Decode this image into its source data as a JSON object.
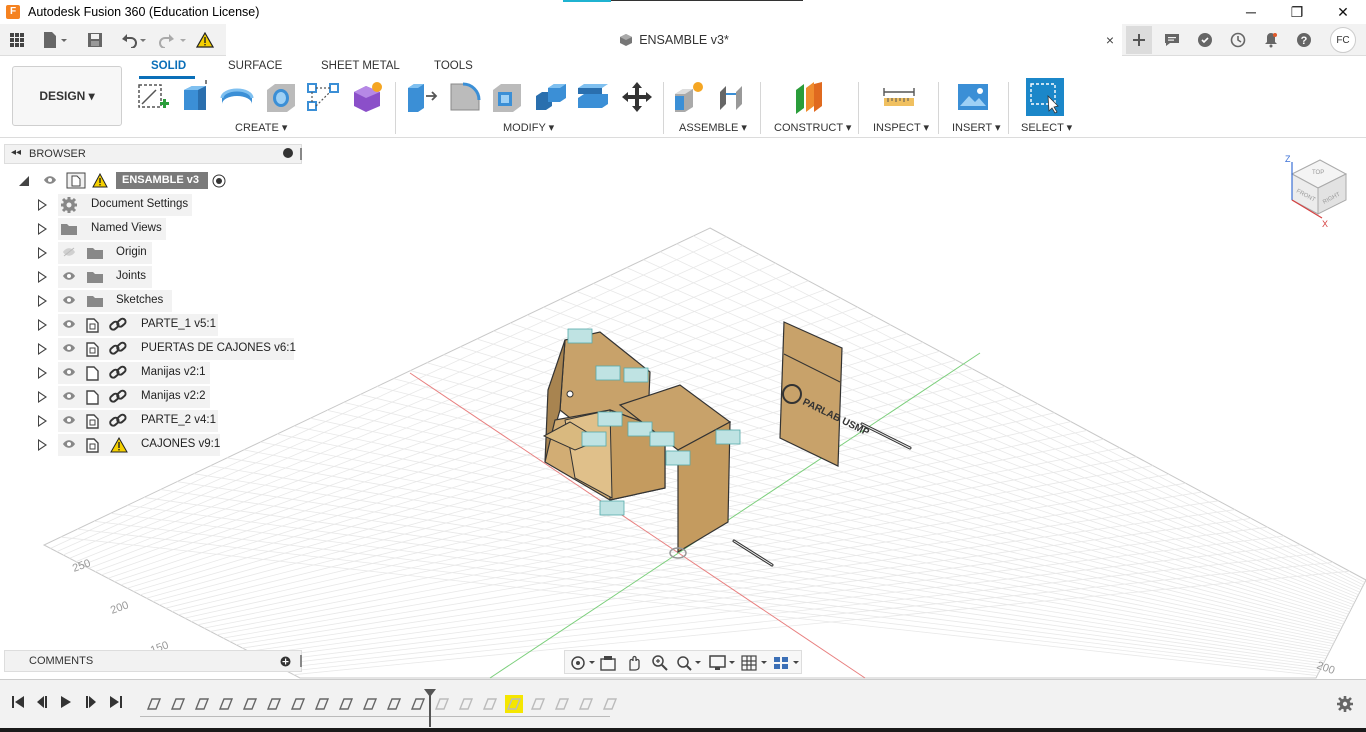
{
  "window": {
    "title": "Autodesk Fusion 360 (Education License)",
    "app_icon": "F",
    "controls": [
      "minimize-icon",
      "maximize-icon",
      "close-icon"
    ]
  },
  "quickbar": {
    "document_tab": "ENSAMBLE v3*",
    "tab_close": "×",
    "avatar_initials": "FC"
  },
  "ribbon": {
    "workspace": "DESIGN ▾",
    "tabs": [
      "SOLID",
      "SURFACE",
      "SHEET METAL",
      "TOOLS"
    ],
    "active_tab": "SOLID",
    "groups": [
      "CREATE ▾",
      "MODIFY ▾",
      "ASSEMBLE ▾",
      "CONSTRUCT ▾",
      "INSPECT ▾",
      "INSERT ▾",
      "SELECT ▾"
    ],
    "accent": "#0a6fb8",
    "select_color": "#1b87c9"
  },
  "browser": {
    "title": "BROWSER",
    "root": "ENSAMBLE v3",
    "items": [
      {
        "label": "Document Settings",
        "icon": "gear-icon"
      },
      {
        "label": "Named Views",
        "icon": "folder-icon"
      },
      {
        "label": "Origin",
        "icon": "folder-icon"
      },
      {
        "label": "Joints",
        "icon": "folder-icon"
      },
      {
        "label": "Sketches",
        "icon": "folder-icon"
      },
      {
        "label": "PARTE_1 v5:1",
        "icon": "component-link-icon"
      },
      {
        "label": "PUERTAS DE CAJONES v6:1",
        "icon": "component-link-icon"
      },
      {
        "label": "Manijas v2:1",
        "icon": "component-link-icon"
      },
      {
        "label": "Manijas v2:2",
        "icon": "component-link-icon"
      },
      {
        "label": "PARTE_2 v4:1",
        "icon": "component-link-icon"
      },
      {
        "label": "CAJONES v9:1",
        "icon": "component-warning-icon"
      }
    ]
  },
  "comments": {
    "title": "COMMENTS"
  },
  "viewcube": {
    "faces": [
      "TOP",
      "FRONT",
      "RIGHT"
    ],
    "axes": [
      "Z",
      "X"
    ]
  },
  "grid_labels": [
    "250",
    "200",
    "150",
    "200"
  ],
  "panel_text": "PARLAB USMP",
  "colors": {
    "wood": "#c8a26a",
    "wood_dark": "#a88450",
    "grid": "#e3e3e3",
    "x_axis": "#e06060",
    "y_axis": "#60c060"
  }
}
